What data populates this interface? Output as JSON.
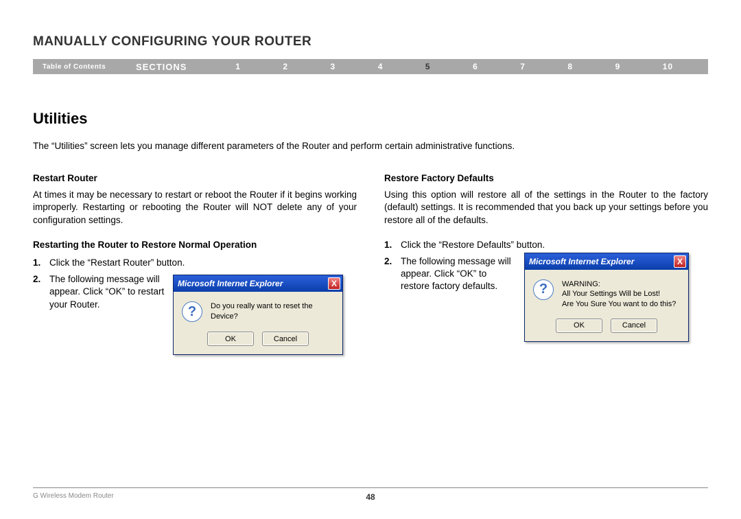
{
  "header": {
    "title": "MANUALLY CONFIGURING YOUR ROUTER",
    "toc_label": "Table of Contents",
    "sections_label": "SECTIONS",
    "numbers": [
      "1",
      "2",
      "3",
      "4",
      "5",
      "6",
      "7",
      "8",
      "9",
      "10"
    ],
    "active": "5"
  },
  "section": {
    "title": "Utilities",
    "intro": "The “Utilities” screen lets you manage different parameters of the Router and perform certain administrative functions."
  },
  "left": {
    "subtitle": "Restart Router",
    "para": "At times it may be necessary to restart or reboot the Router if it begins working improperly. Restarting or rebooting the Router will NOT delete any of your configuration settings.",
    "procedure_title": "Restarting the Router to Restore Normal Operation",
    "step1_num": "1.",
    "step1": "Click the “Restart Router” button.",
    "step2_num": "2.",
    "step2": "The following message will appear. Click “OK” to restart your Router.",
    "dialog": {
      "title": "Microsoft Internet Explorer",
      "message": "Do you really want to reset the Device?",
      "ok": "OK",
      "cancel": "Cancel",
      "close": "X"
    }
  },
  "right": {
    "subtitle": "Restore Factory Defaults",
    "para": "Using this option will restore all of the settings in the Router to the factory (default) settings. It is recommended that you back up your settings before you restore all of the defaults.",
    "step1_num": "1.",
    "step1": "Click the “Restore Defaults” button.",
    "step2_num": "2.",
    "step2": "The following message will appear. Click “OK” to restore factory defaults.",
    "dialog": {
      "title": "Microsoft Internet Explorer",
      "warn": "WARNING:",
      "line1": "All Your Settings Will be Lost!",
      "line2": "Are You Sure You want to do this?",
      "ok": "OK",
      "cancel": "Cancel",
      "close": "X"
    }
  },
  "footer": {
    "product": "G Wireless Modem Router",
    "page": "48"
  }
}
